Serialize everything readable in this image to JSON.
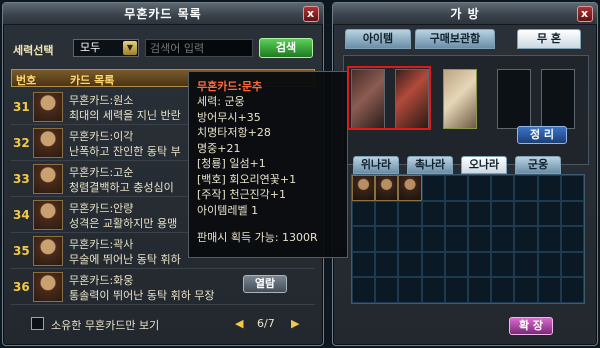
{
  "card_panel": {
    "title": "무혼카드 목록",
    "close": "x",
    "filter_label": "세력선택",
    "faction_selected": "모두",
    "search_placeholder": "검색어 입력",
    "search_button": "검색",
    "header_num": "번호",
    "header_list": "카드 목록",
    "cards": [
      {
        "num": "31",
        "name": "무혼카드:원소",
        "desc": "최대의 세력을 지닌 반란"
      },
      {
        "num": "32",
        "name": "무혼카드:이각",
        "desc": "난폭하고 잔인한 동탁 부"
      },
      {
        "num": "33",
        "name": "무혼카드:고순",
        "desc": "청렴결백하고 충성심이"
      },
      {
        "num": "34",
        "name": "무혼카드:안량",
        "desc": "성격은 교활하지만 용맹"
      },
      {
        "num": "35",
        "name": "무혼카드:곽사",
        "desc": "무술에 뛰어난 동탁 휘하"
      },
      {
        "num": "36",
        "name": "무혼카드:화웅",
        "desc": "통솔력이 뛰어난 동탁 휘하 무장"
      }
    ],
    "view_button": "열람",
    "owned_only_label": "소유한 무혼카드만 보기",
    "page": "6/7",
    "prev": "◀",
    "next": "▶"
  },
  "tooltip": {
    "title": "무혼카드:문추",
    "lines": [
      "세력: 군웅",
      "방어무시+35",
      "치명타저항+28",
      "명중+21",
      "[청룡] 일섬+1",
      "[백호] 회오리연꽃+1",
      "[주작] 천근진각+1",
      "아이템레벨 1"
    ],
    "sell": "판매시 획득 가능: 1300R"
  },
  "bag_panel": {
    "title": "가 방",
    "close": "x",
    "tabs": [
      "아이템",
      "구매보관함",
      "무 혼"
    ],
    "sort_button": "정 리",
    "subtabs": [
      "위나라",
      "촉나라",
      "오나라",
      "군웅"
    ],
    "expand_button": "확 장"
  }
}
